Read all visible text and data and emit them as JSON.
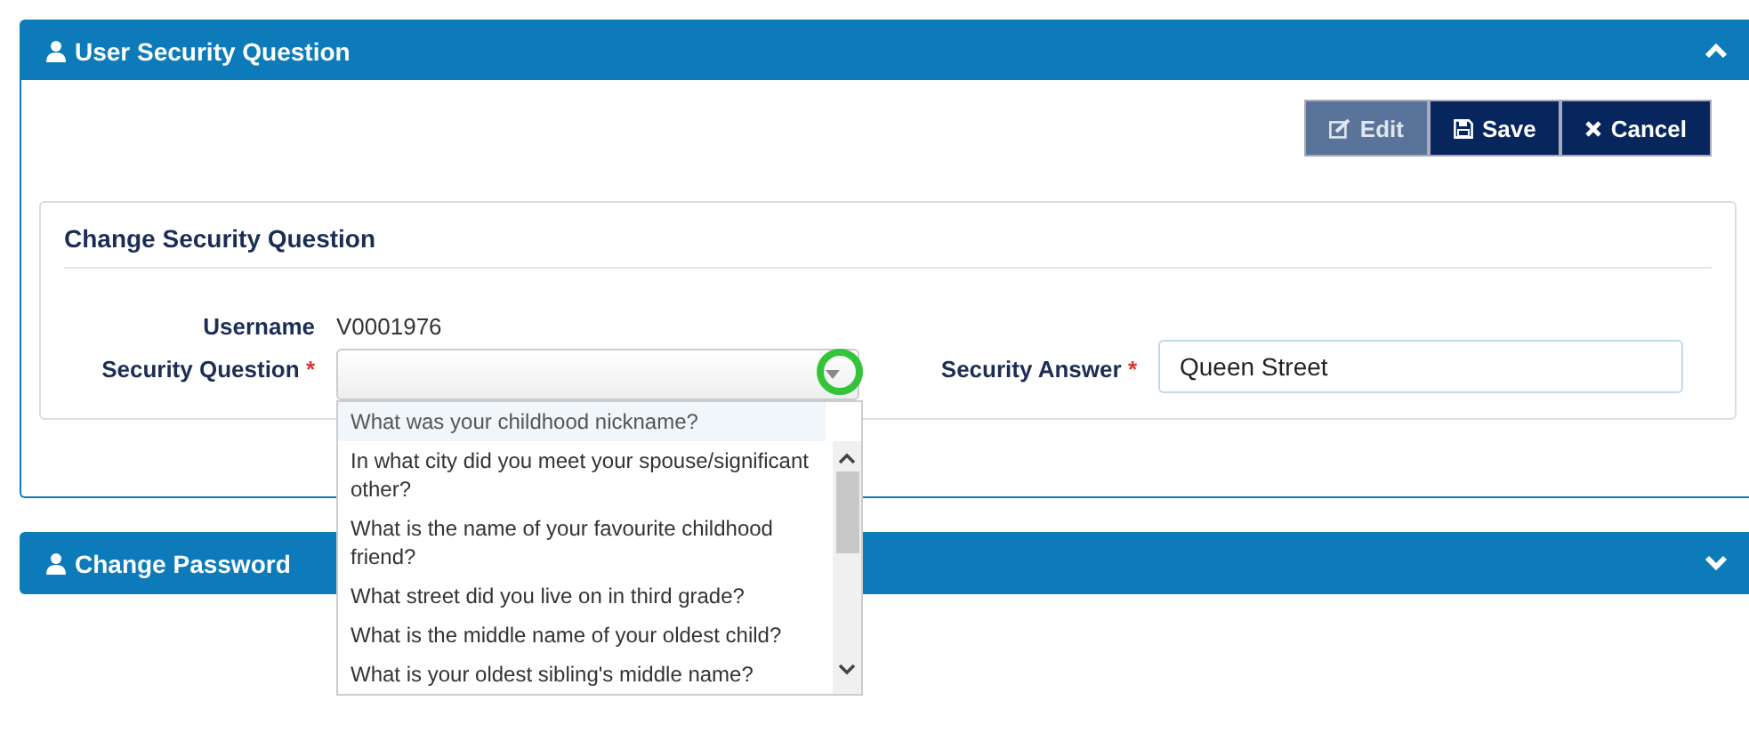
{
  "panels": [
    {
      "title": "User Security Question",
      "expanded": true
    },
    {
      "title": "Change Password",
      "expanded": false
    }
  ],
  "toolbar": [
    {
      "kind": "edit",
      "label": "Edit",
      "disabled": true
    },
    {
      "kind": "save",
      "label": "Save",
      "disabled": false
    },
    {
      "kind": "cancel",
      "label": "Cancel",
      "disabled": false
    }
  ],
  "card": {
    "title": "Change Security Question",
    "username": {
      "label": "Username",
      "value": "V0001976"
    },
    "question": {
      "label": "Security Question",
      "required": "*",
      "expanded": true,
      "options": [
        {
          "label": "What was your childhood nickname?",
          "selected": true
        },
        {
          "label": "In what city did you meet your spouse/significant other?",
          "selected": false
        },
        {
          "label": "What is the name of your favourite childhood friend?",
          "selected": false
        },
        {
          "label": "What street did you live on in third grade?",
          "selected": false
        },
        {
          "label": "What is the middle name of your oldest child?",
          "selected": false
        },
        {
          "label": "What is your oldest sibling's middle name?",
          "selected": false
        }
      ]
    },
    "answer": {
      "label": "Security Answer",
      "required": "*",
      "value": "Queen Street"
    }
  }
}
